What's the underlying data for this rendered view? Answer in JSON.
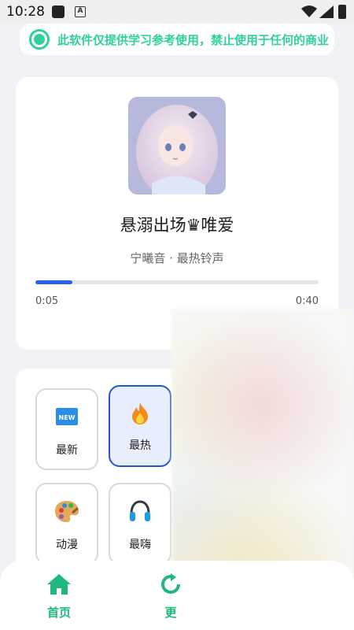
{
  "status_bar": {
    "time": "10:28",
    "app_indicator": "A"
  },
  "notice": {
    "text": "此软件仅提供学习参考使用，禁止使用于任何的商业"
  },
  "player": {
    "cover_icon": "anime-girl-cover",
    "title": "悬溺出场♛唯爱",
    "subtitle": "宁曦音 · 最热铃声",
    "current_time": "0:05",
    "total_time": "0:40",
    "progress": 0.13,
    "accent_color": "#2563eb"
  },
  "categories": [
    {
      "label": "最新",
      "icon": "new-badge-icon",
      "active": false
    },
    {
      "label": "最热",
      "icon": "fire-icon",
      "active": true
    },
    {
      "label": "动漫",
      "icon": "palette-icon",
      "active": false
    },
    {
      "label": "最嗨",
      "icon": "headphones-icon",
      "active": false
    }
  ],
  "bottom_nav": {
    "items": [
      {
        "label": "首页",
        "icon": "home-icon"
      },
      {
        "label": "更",
        "icon": "refresh-icon"
      }
    ],
    "active_color": "#1fb980"
  }
}
